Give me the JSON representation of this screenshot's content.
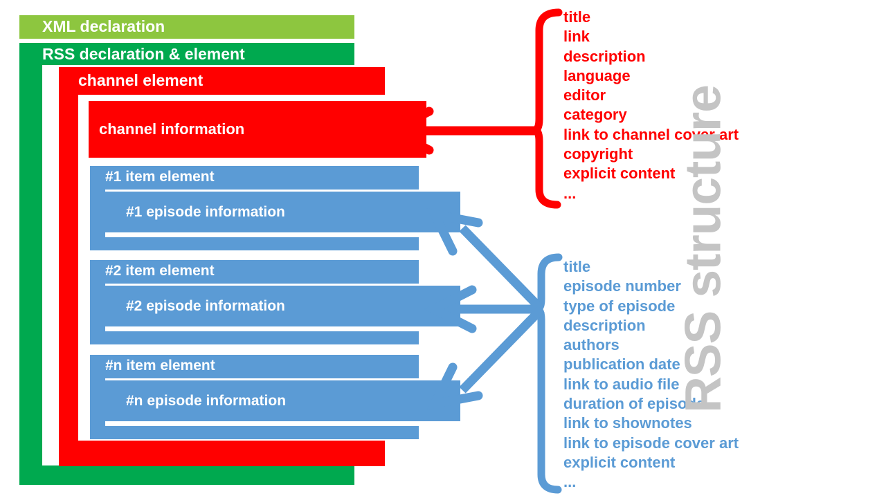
{
  "title_vertical": "RSS structure",
  "boxes": {
    "xml_declaration": "XML declaration",
    "rss_declaration": "RSS declaration & element",
    "channel_element": "channel element",
    "channel_information": "channel information",
    "items": [
      {
        "item_label": "#1 item element",
        "episode_label": "#1 episode information"
      },
      {
        "item_label": "#2 item element",
        "episode_label": "#2 episode information"
      },
      {
        "item_label": "#n item element",
        "episode_label": "#n episode information"
      }
    ]
  },
  "channel_fields": [
    "title",
    "link",
    "description",
    "language",
    "editor",
    "category",
    "link to channel cover art",
    "copyright",
    "explicit content",
    "..."
  ],
  "episode_fields": [
    "title",
    "episode number",
    "type of episode",
    "description",
    "authors",
    "publication date",
    "link to audio file",
    "duration of episode",
    "link to shownotes",
    "link to episode cover art",
    "explicit content",
    "..."
  ],
  "colors": {
    "xml_green": "#8DC63F",
    "rss_green": "#00A94F",
    "channel_red": "#FF0000",
    "item_blue": "#5B9BD5",
    "title_gray": "#C4C4C4",
    "white": "#FFFFFF"
  }
}
